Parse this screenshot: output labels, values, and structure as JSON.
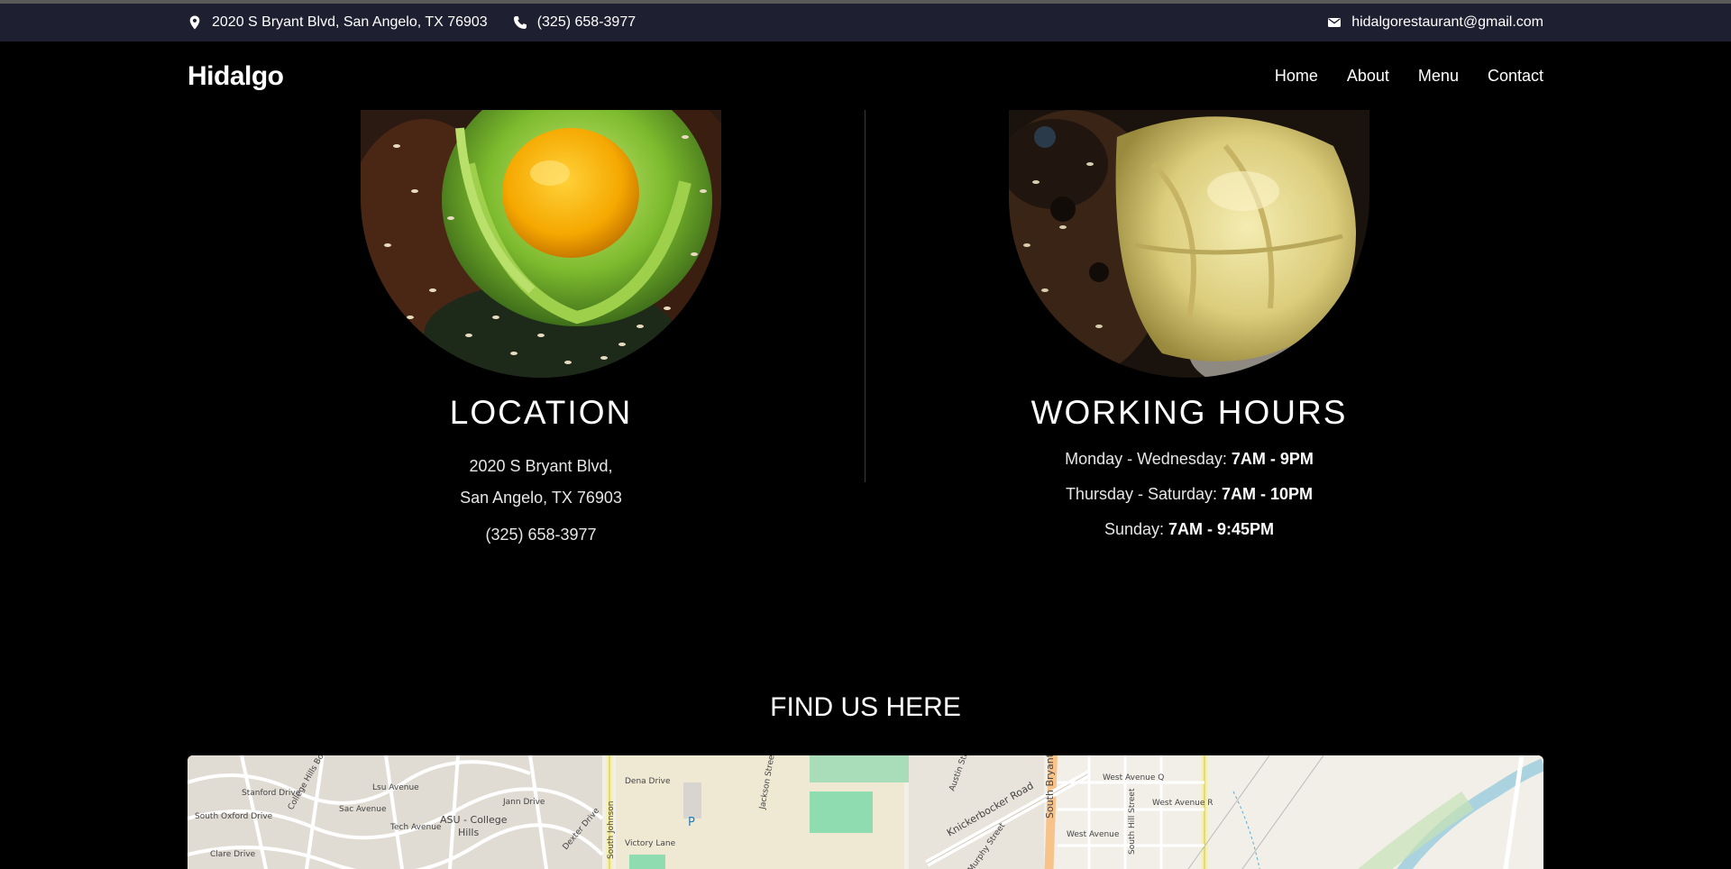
{
  "topbar": {
    "address": "2020 S Bryant Blvd, San Angelo, TX 76903",
    "phone": "(325) 658-3977",
    "email": "hidalgorestaurant@gmail.com",
    "icons": [
      "map-pin-icon",
      "phone-icon",
      "envelope-icon"
    ],
    "background": "#1e1f30"
  },
  "nav": {
    "logo": "Hidalgo",
    "links": [
      "Home",
      "About",
      "Menu",
      "Contact"
    ]
  },
  "location": {
    "title": "LOCATION",
    "line1": "2020 S Bryant Blvd,",
    "line2": "San Angelo, TX 76903",
    "phone": "(325) 658-3977"
  },
  "hours": {
    "title": "WORKING HOURS",
    "rows": [
      {
        "days": "Monday - Wednesday:",
        "time": "7AM - 9PM"
      },
      {
        "days": "Thursday - Saturday:",
        "time": "7AM - 10PM"
      },
      {
        "days": "Sunday:",
        "time": "7AM - 9:45PM"
      }
    ]
  },
  "find": {
    "title": "FIND US HERE"
  },
  "map": {
    "labels": [
      "Stanford Drive",
      "South Oxford Drive",
      "Clare Drive",
      "College Hills Boulevard",
      "Sac Avenue",
      "Lsu Avenue",
      "Tech Avenue",
      "ASU - College",
      "Hills",
      "Dena Drive",
      "Jann Drive",
      "Victory Lane",
      "South Johnson",
      "Jackson Street",
      "Knickerbocker Road",
      "Murphy Street",
      "South Bryant",
      "West Avenue Q",
      "West Avenue R",
      "West Avenue",
      "South Hill Street",
      "Austin Street",
      "Dexter Drive",
      "P"
    ]
  }
}
